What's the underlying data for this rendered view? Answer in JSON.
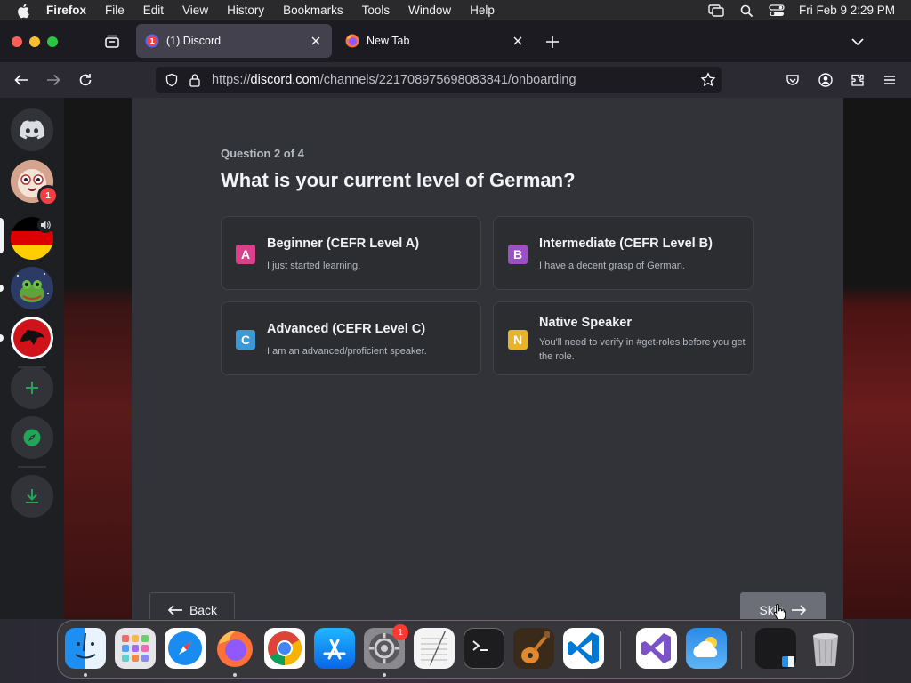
{
  "menubar": {
    "app": "Firefox",
    "items": [
      "File",
      "Edit",
      "View",
      "History",
      "Bookmarks",
      "Tools",
      "Window",
      "Help"
    ],
    "clock": "Fri Feb 9  2:29 PM"
  },
  "browser": {
    "tabs": [
      {
        "label": "(1) Discord",
        "favicon_badge": "1",
        "active": true
      },
      {
        "label": "New Tab",
        "active": false
      }
    ],
    "url_prefix": "https://",
    "url_host": "discord.com",
    "url_path": "/channels/221708975698083841/onboarding"
  },
  "sidebar": {
    "servers": [
      {
        "name": "home",
        "icon": "discord-logo-icon"
      },
      {
        "name": "server-avatar",
        "badge": "1"
      },
      {
        "name": "german-flag-server",
        "speaker": true,
        "selected": true
      },
      {
        "name": "frog-server",
        "unread": true
      },
      {
        "name": "red-emblem-server",
        "unread": true
      }
    ],
    "actions": [
      "plus-icon",
      "compass-icon",
      "download-icon"
    ]
  },
  "onboarding": {
    "question_label": "Question 2 of 4",
    "question": "What is your current level of German?",
    "options": [
      {
        "letter": "A",
        "title": "Beginner (CEFR Level A)",
        "description": "I just started learning.",
        "color": "#d9418a"
      },
      {
        "letter": "B",
        "title": "Intermediate (CEFR Level B)",
        "description": "I have a decent grasp of German.",
        "color": "#9c50c6"
      },
      {
        "letter": "C",
        "title": "Advanced (CEFR Level C)",
        "description": "I am an advanced/proficient speaker.",
        "color": "#3c99d6"
      },
      {
        "letter": "N",
        "title": "Native Speaker",
        "description": "You'll need to verify in #get-roles before you get the role.",
        "color": "#e8b32b"
      }
    ],
    "back_label": "Back",
    "skip_label": "Skip"
  },
  "dock": {
    "apps": [
      "Finder",
      "Launchpad",
      "Safari",
      "Firefox",
      "Chrome",
      "App Store",
      "System Settings",
      "TextEdit",
      "Terminal",
      "GarageBand",
      "Visual Studio Code",
      "Visual Studio",
      "Weather",
      "Finder Window",
      "Trash"
    ],
    "system_settings_badge": "1"
  },
  "colors": {
    "accent_green": "#23a559",
    "panel": "#313338",
    "rail": "#1e1f22"
  }
}
